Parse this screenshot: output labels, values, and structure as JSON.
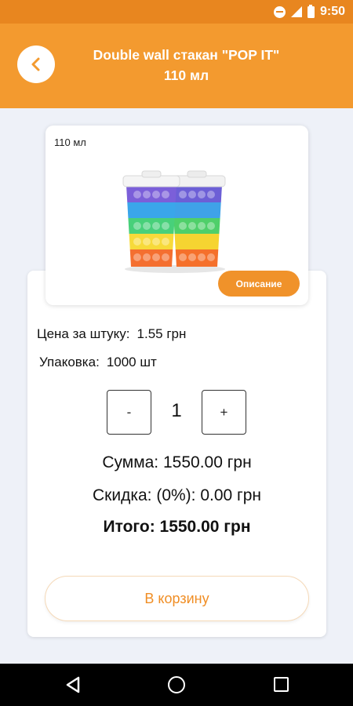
{
  "status_bar": {
    "time": "9:50"
  },
  "header": {
    "title_line1": "Double wall стакан \"POP IT\"",
    "title_line2": "110 мл",
    "color": "#f39a2f"
  },
  "product": {
    "image_caption": "110 мл",
    "image_alt": "POP IT double wall cups",
    "description_button": "Описание"
  },
  "details": {
    "price_label": "Цена за штуку:",
    "price_value": "1.55 грн",
    "pack_label": "Упаковка:",
    "pack_value": "1000 шт"
  },
  "quantity": {
    "minus": "-",
    "value": "1",
    "plus": "+"
  },
  "totals": {
    "sum": "Сумма: 1550.00 грн",
    "discount": "Скидка: (0%): 0.00 грн",
    "total": "Итого: 1550.00 грн"
  },
  "cart_button": "В корзину",
  "accent_color": "#f0922a"
}
